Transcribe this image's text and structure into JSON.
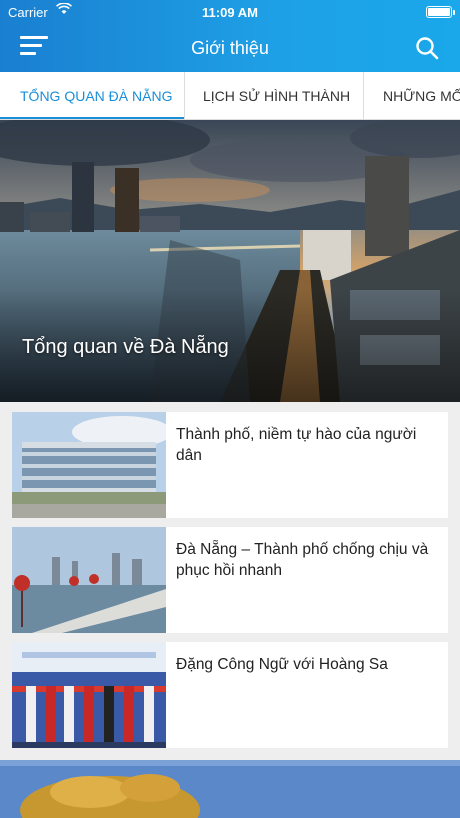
{
  "status_bar": {
    "carrier": "Carrier",
    "time": "11:09 AM"
  },
  "header": {
    "title": "Giới thiệu"
  },
  "tabs": [
    {
      "label": "TỔNG QUAN ĐÀ NẴNG"
    },
    {
      "label": "LỊCH SỬ HÌNH THÀNH"
    },
    {
      "label": "NHỮNG MỐC"
    }
  ],
  "hero": {
    "caption": "Tổng quan về Đà Nẵng"
  },
  "articles": [
    {
      "title": "Thành phố, niềm tự hào của người dân"
    },
    {
      "title": "Đà Nẵng – Thành phố chống chịu và phục hồi nhanh"
    },
    {
      "title": "Đặng Công Ngữ với Hoàng Sa"
    }
  ],
  "colors": {
    "header": "#1a8fd8",
    "tab_active": "#1a8fd8"
  }
}
